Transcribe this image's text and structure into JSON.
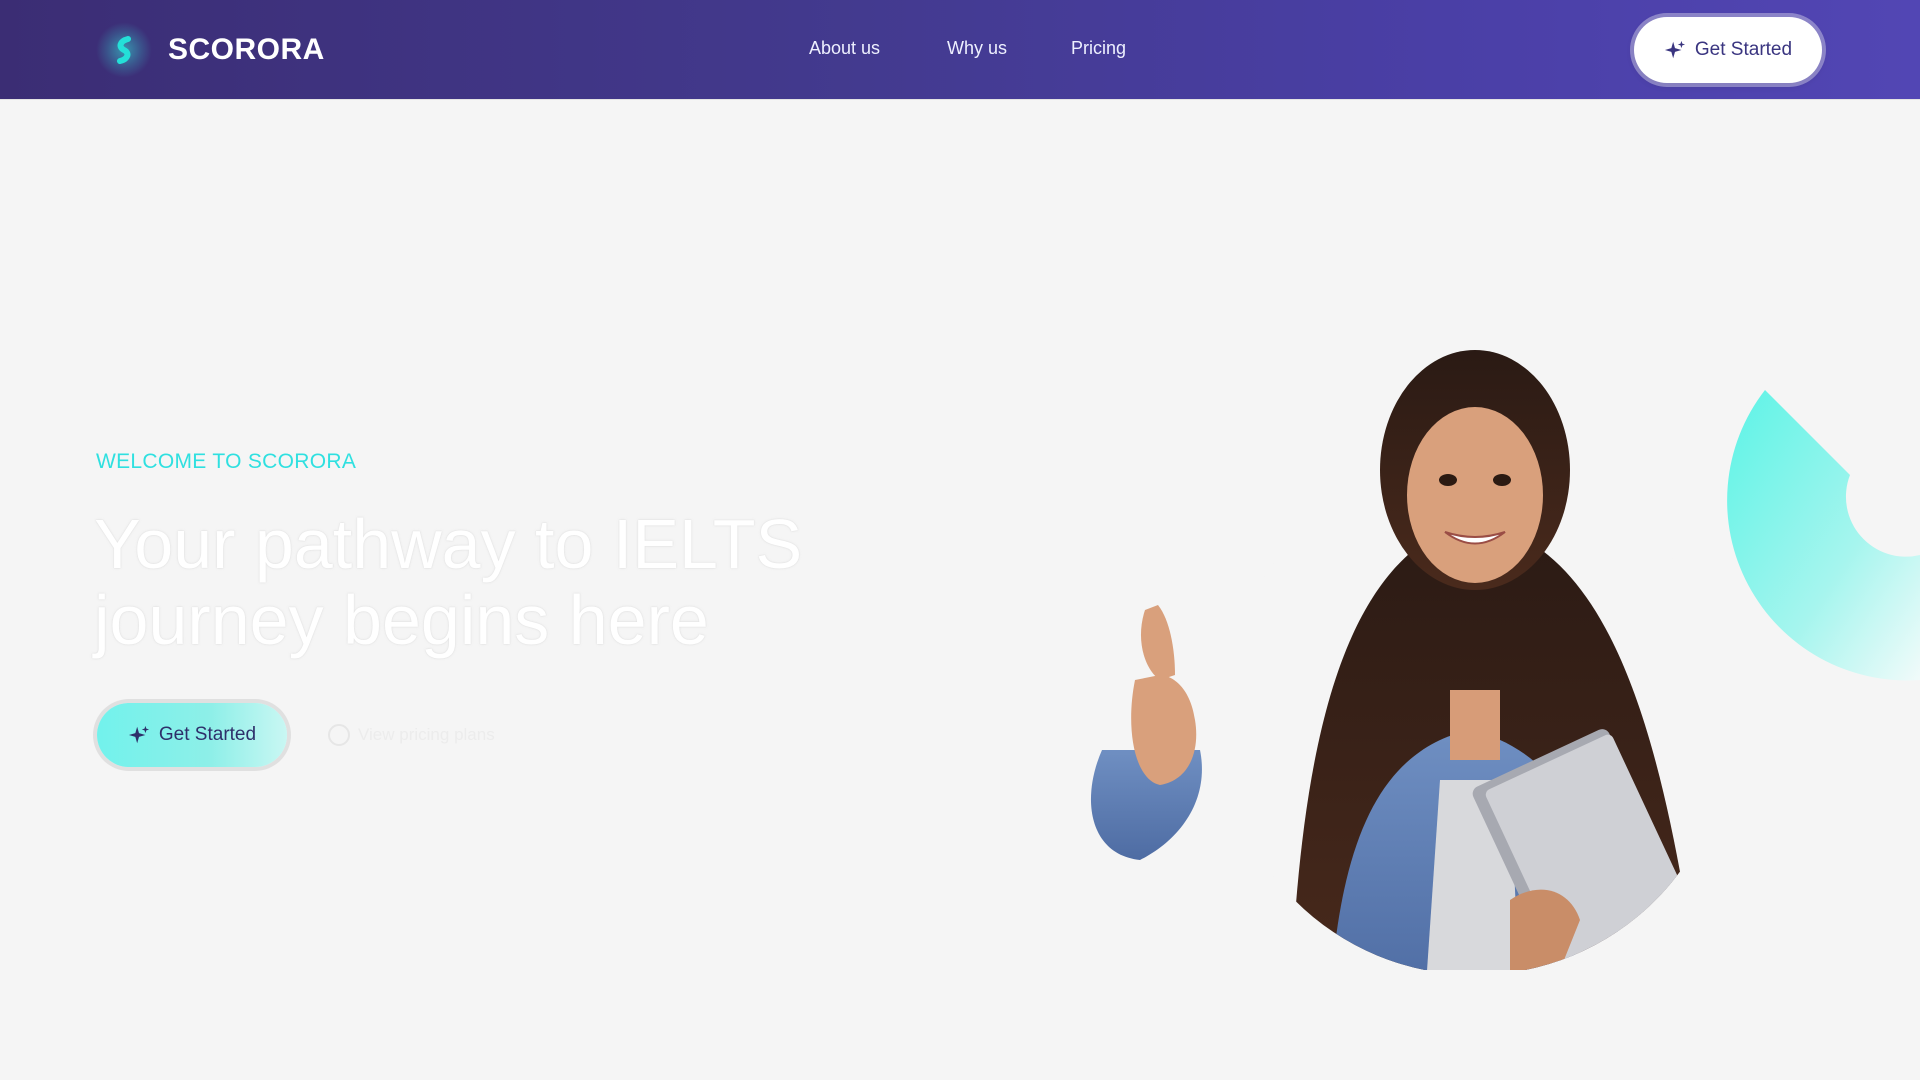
{
  "brand": {
    "name": "SCORORA",
    "icon": "scorora-s-logo-icon"
  },
  "nav": {
    "items": [
      {
        "label": "About us"
      },
      {
        "label": "Why us"
      },
      {
        "label": "Pricing"
      }
    ]
  },
  "header": {
    "cta_label": "Get Started",
    "cta_icon": "sparkle-icon"
  },
  "hero": {
    "eyebrow": "WELCOME TO SCORORA",
    "headline_line1": "Your pathway to IELTS",
    "headline_line2": "journey begins here",
    "cta_label": "Get Started",
    "secondary_link": "View pricing plans",
    "secondary_icon": "circle-play-icon"
  },
  "colors": {
    "header_gradient_start": "#3b2d74",
    "header_gradient_end": "#5246b4",
    "accent_cyan": "#2fe0e0",
    "button_cyan": "#72f2ec",
    "page_background": "#f5f5f5",
    "cta_text": "#3a3580"
  }
}
